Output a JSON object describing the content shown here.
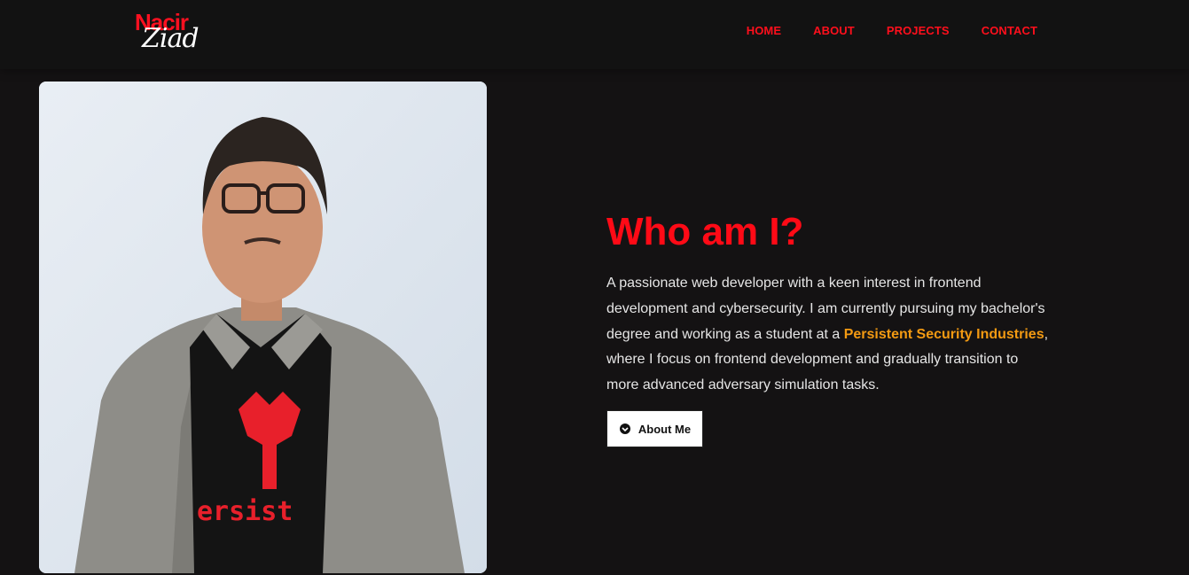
{
  "header": {
    "logo_top": "Nacir",
    "logo_bottom": "Ziad"
  },
  "nav": {
    "items": [
      "HOME",
      "ABOUT",
      "PROJECTS",
      "CONTACT"
    ]
  },
  "hero": {
    "title": "Who am I?",
    "desc_part1": "A passionate web developer with a keen interest in frontend development and cybersecurity. I am currently pursuing my bachelor's degree and working as a student at a ",
    "highlight": "Persistent Security Industries",
    "desc_part2": ", where I focus on frontend development and gradually transition to more advanced adversary simulation tasks.",
    "button_label": "About Me",
    "button_icon": "chevron-down-circle-icon",
    "photo_alt": "Portrait photo"
  },
  "colors": {
    "background": "#141213",
    "accent_red": "#ff0a16",
    "highlight_orange": "#f39a12",
    "text": "#e6e6e6"
  }
}
